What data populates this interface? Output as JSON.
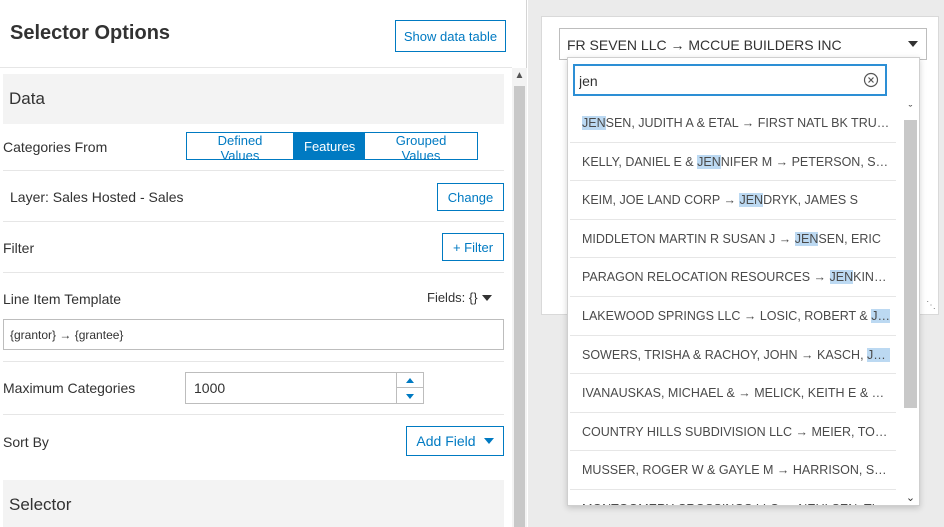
{
  "panel": {
    "title": "Selector Options",
    "show_table_label": "Show data table"
  },
  "data_section": {
    "heading": "Data",
    "categories_from_label": "Categories From",
    "segments": [
      "Defined Values",
      "Features",
      "Grouped Values"
    ],
    "active_segment": "Features",
    "layer_label": "Layer: Sales Hosted - Sales",
    "change_label": "Change",
    "filter_label": "Filter",
    "add_filter_label": "+ Filter",
    "line_item_template_label": "Line Item Template",
    "fields_label": "Fields: {}",
    "template_value": "{grantor} → {grantee}",
    "max_categories_label": "Maximum Categories",
    "max_categories_value": "1000",
    "sort_by_label": "Sort By",
    "add_field_label": "Add Field"
  },
  "selector_section": {
    "heading": "Selector"
  },
  "preview": {
    "selected_value": "FR SEVEN LLC → MCCUE BUILDERS INC",
    "search_value": "jen",
    "highlight_color": "#bcd9f2",
    "accent_color": "#007ac2",
    "items": [
      "JENSEN, JUDITH A & ETAL → FIRST NATL BK TRUST ...",
      "KELLY, DANIEL E & JENNIFER M → PETERSON, SCO...",
      "KEIM, JOE LAND CORP → JENDRYK, JAMES S",
      "MIDDLETON MARTIN R SUSAN J → JENSEN, ERIC",
      "PARAGON RELOCATION RESOURCES → JENKINS, ...",
      "LAKEWOOD SPRINGS LLC → LOSIC, ROBERT & JEN...",
      "SOWERS, TRISHA & RACHOY, JOHN → KASCH, JEN...",
      "IVANAUSKAS, MICHAEL & → MELICK, KEITH E & JE...",
      "COUNTRY HILLS SUBDIVISION LLC → MEIER, TODD ...",
      "MUSSER, ROGER W & GAYLE M → HARRISON, STEV...",
      "MONTGOMERY CROSSINGS LLC → NEULSEN, TIM..."
    ]
  }
}
